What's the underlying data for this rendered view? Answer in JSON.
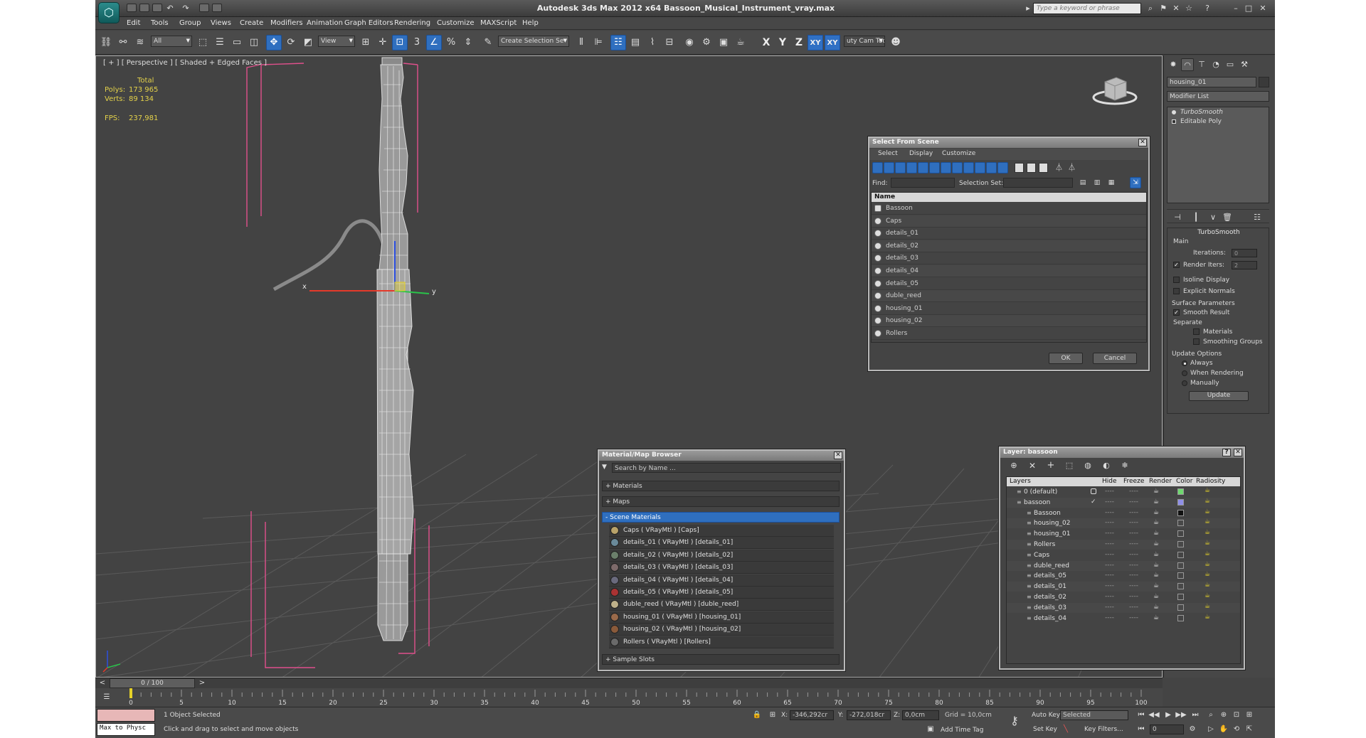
{
  "titlebar": {
    "title": "Autodesk 3ds Max  2012 x64     Bassoon_Musical_Instrument_vray.max",
    "search_placeholder": "Type a keyword or phrase",
    "logo": "3ds-max-logo"
  },
  "menu": [
    "Edit",
    "Tools",
    "Group",
    "Views",
    "Create",
    "Modifiers",
    "Animation",
    "Graph Editors",
    "Rendering",
    "Customize",
    "MAXScript",
    "Help"
  ],
  "toolbar": {
    "filter_value": "All",
    "ref_coord_value": "View",
    "selection_set_placeholder": "Create Selection Se",
    "axis_x": "X",
    "axis_y": "Y",
    "axis_z": "Z",
    "axis_xy": "XY",
    "axis_xy2": "XY",
    "cam_tool": "uty Cam Tool \\"
  },
  "viewport": {
    "label": "[ + ] [ Perspective ] [ Shaded + Edged Faces ]",
    "stats": {
      "header": "Total",
      "polys_label": "Polys:",
      "polys_value": "173 965",
      "verts_label": "Verts:",
      "verts_value": "89 134",
      "fps_label": "FPS:",
      "fps_value": "237,981"
    },
    "gizmo_x": "x",
    "gizmo_y": "y"
  },
  "command_panel": {
    "object_name": "housing_01",
    "modifier_list": "Modifier List",
    "stack": [
      "TurboSmooth",
      "Editable Poly"
    ],
    "turbosmooth": {
      "title": "TurboSmooth",
      "main": "Main",
      "iterations_label": "Iterations:",
      "iterations_value": "0",
      "render_iters_label": "Render Iters:",
      "render_iters_value": "2",
      "isoline": "Isoline Display",
      "explicit": "Explicit Normals",
      "surface_params": "Surface Parameters",
      "smooth_result": "Smooth Result",
      "separate": "Separate",
      "materials": "Materials",
      "smoothing_groups": "Smoothing Groups",
      "update_options": "Update Options",
      "always": "Always",
      "when_rendering": "When Rendering",
      "manually": "Manually",
      "update_btn": "Update"
    }
  },
  "select_from_scene": {
    "title": "Select From Scene",
    "menu": [
      "Select",
      "Display",
      "Customize"
    ],
    "find_label": "Find:",
    "selection_set_label": "Selection Set:",
    "column_name": "Name",
    "items": [
      "Bassoon",
      "Caps",
      "details_01",
      "details_02",
      "details_03",
      "details_04",
      "details_05",
      "duble_reed",
      "housing_01",
      "housing_02",
      "Rollers"
    ],
    "ok": "OK",
    "cancel": "Cancel"
  },
  "material_browser": {
    "title": "Material/Map Browser",
    "search_placeholder": "Search by Name ...",
    "groups": {
      "materials": "+ Materials",
      "maps": "+ Maps",
      "scene_materials": "- Scene Materials",
      "sample_slots": "+ Sample Slots"
    },
    "items": [
      "Caps  ( VRayMtl ) [Caps]",
      "details_01  ( VRayMtl ) [details_01]",
      "details_02  ( VRayMtl ) [details_02]",
      "details_03  ( VRayMtl ) [details_03]",
      "details_04  ( VRayMtl ) [details_04]",
      "details_05  ( VRayMtl ) [details_05]",
      "duble_reed  ( VRayMtl ) [duble_reed]",
      "housing_01  ( VRayMtl ) [housing_01]",
      "housing_02  ( VRayMtl ) [housing_02]",
      "Rollers  ( VRayMtl ) [Rollers]"
    ]
  },
  "layer_dialog": {
    "title": "Layer: bassoon",
    "help": "?",
    "columns": {
      "layers": "Layers",
      "hide": "Hide",
      "freeze": "Freeze",
      "render": "Render",
      "color": "Color",
      "radiosity": "Radiosity"
    },
    "rows": [
      {
        "name": "0 (default)",
        "level": 1,
        "color": "#6fd86f"
      },
      {
        "name": "bassoon",
        "level": 1,
        "color": "#8f8fe8"
      },
      {
        "name": "Bassoon",
        "level": 2,
        "color": "#111111"
      },
      {
        "name": "housing_02",
        "level": 2,
        "color": ""
      },
      {
        "name": "housing_01",
        "level": 2,
        "color": ""
      },
      {
        "name": "Rollers",
        "level": 2,
        "color": ""
      },
      {
        "name": "Caps",
        "level": 2,
        "color": ""
      },
      {
        "name": "duble_reed",
        "level": 2,
        "color": ""
      },
      {
        "name": "details_05",
        "level": 2,
        "color": ""
      },
      {
        "name": "details_01",
        "level": 2,
        "color": ""
      },
      {
        "name": "details_02",
        "level": 2,
        "color": ""
      },
      {
        "name": "details_03",
        "level": 2,
        "color": ""
      },
      {
        "name": "details_04",
        "level": 2,
        "color": ""
      }
    ],
    "dash": "----"
  },
  "timeline": {
    "frame": "0 / 100",
    "ticks": [
      "0",
      "5",
      "10",
      "15",
      "20",
      "25",
      "30",
      "35",
      "40",
      "45",
      "50",
      "55",
      "60",
      "65",
      "70",
      "75",
      "80",
      "85",
      "90",
      "95",
      "100"
    ]
  },
  "status": {
    "maxscript": "Max to Physc",
    "selected": "1 Object Selected",
    "prompt": "Click and drag to select and move objects",
    "x_label": "X:",
    "x_value": "-346,292cr",
    "y_label": "Y:",
    "y_value": "-272,018cr",
    "z_label": "Z:",
    "z_value": "0,0cm",
    "grid": "Grid = 10,0cm",
    "add_time_tag": "Add Time Tag",
    "auto_key": "Auto Key",
    "selected_dd": "Selected",
    "set_key": "Set Key",
    "key_filters": "Key Filters...",
    "frame_value": "0"
  },
  "colors": {
    "accent": "#2f6fbf",
    "bounding_box": "#e0508c",
    "stats_text": "#e4d24a"
  }
}
